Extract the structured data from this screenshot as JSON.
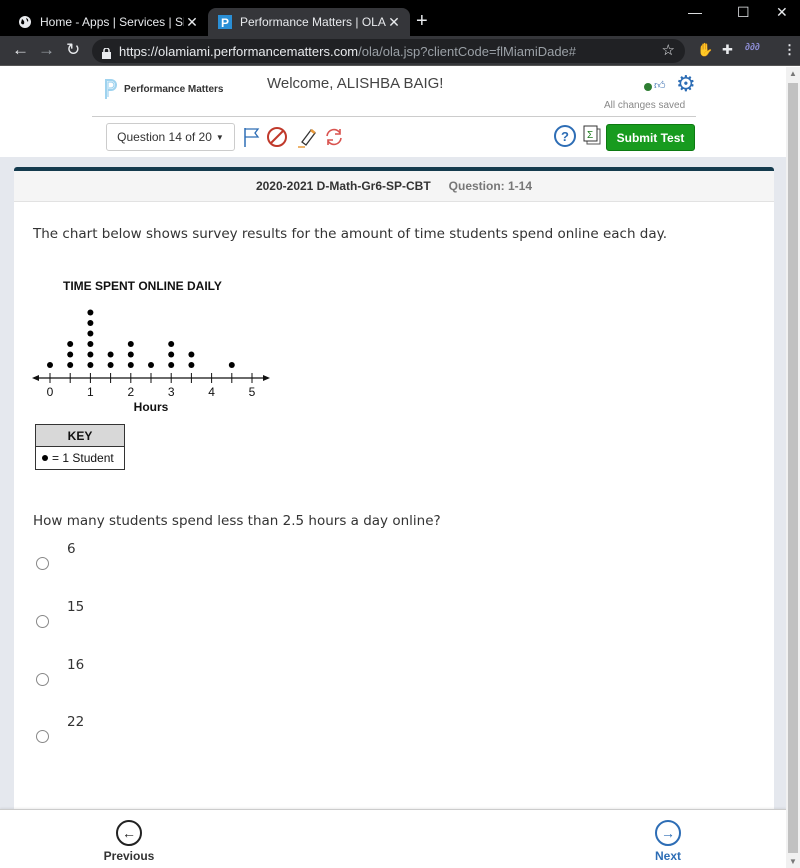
{
  "browser": {
    "tabs": [
      {
        "title": "Home - Apps | Services | Sites",
        "icon": "globe-icon",
        "active": false
      },
      {
        "title": "Performance Matters | OLA",
        "icon": "performance-matters-favicon",
        "active": true
      }
    ],
    "new_tab_label": "+",
    "url_host": "https://olamiami.performancematters.com",
    "url_path": "/ola/ola.jsp?clientCode=flMiamiDade#",
    "window_controls": {
      "minimize": "—",
      "maximize": "☐",
      "close": "✕"
    }
  },
  "header": {
    "logo_text": "Performance Matters",
    "welcome": "Welcome, ALISHBA BAIG!",
    "save_status": "All changes saved"
  },
  "toolbar": {
    "question_select": "Question 14 of 20",
    "tools": [
      "flag-icon",
      "eliminate-icon",
      "highlighter-icon",
      "refresh-icon"
    ],
    "help_label": "?",
    "submit_label": "Submit Test"
  },
  "card": {
    "test_name": "2020-2021 D-Math-Gr6-SP-CBT",
    "question_id": "Question: 1-14",
    "prompt": "The chart below shows survey results for the amount of time students spend online each day.",
    "key_title": "KEY",
    "key_text": "= 1 Student",
    "question": "How many students spend less than 2.5 hours a day online?",
    "choices": [
      "6",
      "15",
      "16",
      "22"
    ]
  },
  "chart_data": {
    "type": "scatter",
    "subtype": "dot-plot",
    "title": "TIME SPENT ONLINE DAILY",
    "xlabel": "Hours",
    "ylabel": "",
    "xlim": [
      0,
      5
    ],
    "x_ticks": [
      0,
      0.5,
      1,
      1.5,
      2,
      2.5,
      3,
      3.5,
      4,
      4.5,
      5
    ],
    "x_tick_labels": [
      "0",
      "1",
      "2",
      "3",
      "4",
      "5"
    ],
    "x": [
      0,
      0.5,
      1,
      1.5,
      2,
      2.5,
      3,
      3.5,
      4,
      4.5,
      5
    ],
    "counts": [
      1,
      3,
      6,
      2,
      3,
      1,
      3,
      2,
      0,
      1,
      0
    ],
    "legend": "● = 1 Student"
  },
  "footer": {
    "previous_label": "Previous",
    "next_label": "Next"
  }
}
